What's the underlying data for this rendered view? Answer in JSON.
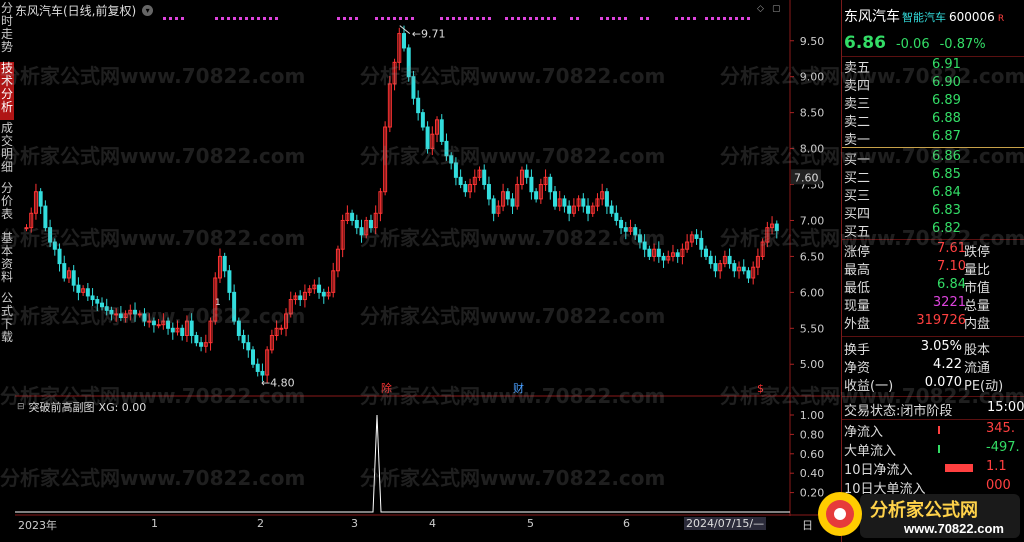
{
  "left_tabs": [
    {
      "label": "分时走势",
      "active": false
    },
    {
      "label": "技术分析",
      "active": true
    },
    {
      "label": "成交明细",
      "active": false
    },
    {
      "label": "分价表",
      "active": false
    },
    {
      "label": "基本资料",
      "active": false
    },
    {
      "label": "公式下载",
      "active": false
    }
  ],
  "chart": {
    "stock_title": "东风汽车(日线,前复权)",
    "high_marker": "9.71",
    "low_marker": "4.80",
    "current_price_tag": "7.60",
    "y_ticks": [
      "9.50",
      "9.00",
      "8.50",
      "8.00",
      "7.50",
      "7.00",
      "6.50",
      "6.00",
      "5.50",
      "5.00"
    ],
    "event_markers": [
      {
        "label": "除",
        "color": "#ff3333"
      },
      {
        "label": "财",
        "color": "#4aa0ff"
      },
      {
        "label": "$",
        "color": "#ff3333"
      }
    ],
    "small_label": "1"
  },
  "indicator": {
    "title": "突破前高副图",
    "value": "XG: 0.00",
    "y_ticks": [
      "1.00",
      "0.80",
      "0.60",
      "0.40",
      "0.20"
    ]
  },
  "dates": [
    "2023年",
    "1",
    "2",
    "3",
    "4",
    "5",
    "6",
    "2024/07/15/—"
  ],
  "period_button": "日",
  "quote": {
    "name": "东风汽车",
    "sector": "智能汽车",
    "code": "600006",
    "badge": "R",
    "price": "6.86",
    "change": "-0.06",
    "change_pct": "-0.87%",
    "asks": [
      {
        "label": "卖五",
        "price": "6.91"
      },
      {
        "label": "卖四",
        "price": "6.90"
      },
      {
        "label": "卖三",
        "price": "6.89"
      },
      {
        "label": "卖二",
        "price": "6.88"
      },
      {
        "label": "卖一",
        "price": "6.87"
      }
    ],
    "bids": [
      {
        "label": "买一",
        "price": "6.86"
      },
      {
        "label": "买二",
        "price": "6.85"
      },
      {
        "label": "买三",
        "price": "6.84"
      },
      {
        "label": "买四",
        "price": "6.83"
      },
      {
        "label": "买五",
        "price": "6.82"
      }
    ],
    "stats": [
      {
        "label": "涨停",
        "value": "7.61",
        "label2": "跌停"
      },
      {
        "label": "最高",
        "value": "7.10",
        "label2": "量比"
      },
      {
        "label": "最低",
        "value": "6.84",
        "label2": "市值"
      },
      {
        "label": "现量",
        "value": "3221",
        "label2": "总量"
      },
      {
        "label": "外盘",
        "value": "319726",
        "label2": "内盘"
      }
    ],
    "stats2": [
      {
        "label": "换手",
        "value": "3.05%",
        "label2": "股本"
      },
      {
        "label": "净资",
        "value": "4.22",
        "label2": "流通"
      },
      {
        "label": "收益(一)",
        "value": "0.070",
        "label2": "PE(动)"
      }
    ],
    "trade_status_label": "交易状态:",
    "trade_status": "闭市阶段",
    "trade_time": "15:00",
    "flows": [
      {
        "label": "净流入",
        "value": "345."
      },
      {
        "label": "大单流入",
        "value": "-497."
      },
      {
        "label": "10日净流入",
        "value": "1.1"
      },
      {
        "label": "10日大单流入",
        "value": "000"
      }
    ]
  },
  "watermark": "分析家公式网www.70822.com",
  "logo": {
    "text": "分析家公式网",
    "url": "www.70822.com"
  },
  "colors": {
    "up": "#ff3333",
    "down": "#33dddd",
    "accent": "#b01515",
    "marker": "#dd44dd"
  },
  "chart_data": {
    "type": "candlestick",
    "ylim": [
      4.6,
      9.9
    ],
    "high": 9.71,
    "low": 4.8,
    "last": 6.86,
    "indicator_series": {
      "name": "XG",
      "signal_index_fraction": 0.44,
      "values_range": [
        0,
        1
      ]
    }
  }
}
